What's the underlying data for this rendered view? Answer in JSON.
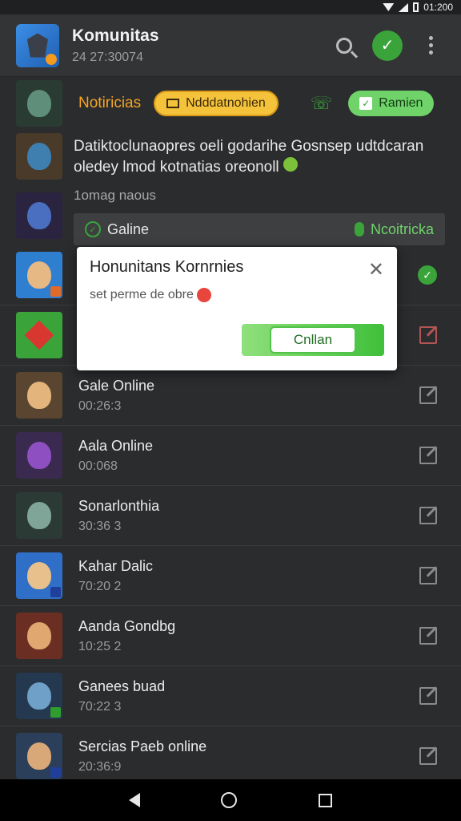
{
  "status_bar": {
    "time": "01:200"
  },
  "header": {
    "title": "Komunitas",
    "subtitle": "24 27:30074",
    "icons": [
      "app-icon",
      "search-icon",
      "check-icon",
      "more-vert-icon"
    ]
  },
  "notification_row": {
    "title": "Notiricias",
    "orange_pill": "Ndddatnohien",
    "green_pill": "Ramien"
  },
  "description": {
    "text": "Datiktoclunaopres oeli godarihe Gosnsep udtdcaran oledey lmod kotnatias oreonoll",
    "sub": "1omag naous",
    "strip_left": "Galine",
    "strip_right": "Ncoitricka"
  },
  "dialog": {
    "title": "Honunitans Kornrnies",
    "message": "set perme de obre",
    "button": "Cnllan"
  },
  "rows": [
    {
      "name": "Gale Online",
      "time": "00:26:3"
    },
    {
      "name": "Aala Online",
      "time": "00:068"
    },
    {
      "name": "Sonarlonthia",
      "time": "30:36 3"
    },
    {
      "name": "Kahar Dalic",
      "time": "70:20 2"
    },
    {
      "name": "Aanda Gondbg",
      "time": "10:25 2"
    },
    {
      "name": "Ganees buad",
      "time": "70:22 3"
    },
    {
      "name": "Sercias Paeb online",
      "time": "20:36:9"
    }
  ],
  "colors": {
    "accent_green": "#3aa43a",
    "accent_orange": "#f5a623",
    "background": "#2b2c2e"
  }
}
